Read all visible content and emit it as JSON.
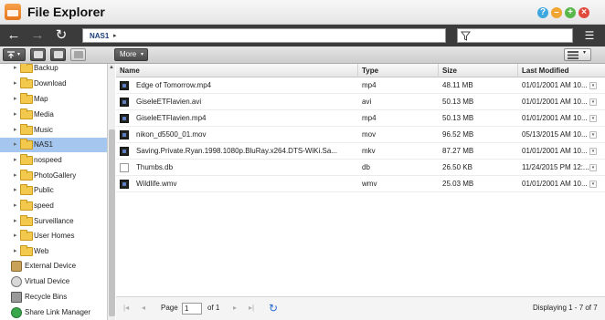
{
  "window": {
    "title": "File Explorer",
    "controls": [
      "?",
      "–",
      "+",
      "×"
    ]
  },
  "nav": {
    "back_icon": "←",
    "forward_icon": "→",
    "refresh_icon": "↻",
    "path_segment": "NAS1",
    "path_arrow": "▸",
    "filter_icon": "filter-icon",
    "filter_value": "",
    "view_icon": "☰"
  },
  "toolbar": {
    "more_label": "More",
    "more_arrow": "▾"
  },
  "sidebar": {
    "folders": [
      {
        "label": "Backup"
      },
      {
        "label": "Download"
      },
      {
        "label": "Map"
      },
      {
        "label": "Media"
      },
      {
        "label": "Music"
      },
      {
        "label": "NAS1",
        "selected": true
      },
      {
        "label": "nospeed"
      },
      {
        "label": "PhotoGallery"
      },
      {
        "label": "Public"
      },
      {
        "label": "speed"
      },
      {
        "label": "Surveillance"
      },
      {
        "label": "User Homes"
      },
      {
        "label": "Web"
      }
    ],
    "roots": [
      {
        "label": "External Device",
        "icon": "external-device-icon"
      },
      {
        "label": "Virtual Device",
        "icon": "virtual-device-icon"
      },
      {
        "label": "Recycle Bins",
        "icon": "recycle-bin-icon"
      },
      {
        "label": "Share Link Manager",
        "icon": "share-link-icon"
      }
    ]
  },
  "grid": {
    "columns": [
      "Name",
      "Type",
      "Size",
      "Last Modified"
    ],
    "rows": [
      {
        "name": "Edge of Tomorrow.mp4",
        "type": "mp4",
        "size": "48.11 MB",
        "modified": "01/01/2001 AM 10...",
        "icon": "video"
      },
      {
        "name": "GiseleETFlavien.avi",
        "type": "avi",
        "size": "50.13 MB",
        "modified": "01/01/2001 AM 10...",
        "icon": "video"
      },
      {
        "name": "GiseleETFlavien.mp4",
        "type": "mp4",
        "size": "50.13 MB",
        "modified": "01/01/2001 AM 10...",
        "icon": "video"
      },
      {
        "name": "nikon_d5500_01.mov",
        "type": "mov",
        "size": "96.52 MB",
        "modified": "05/13/2015 AM 10...",
        "icon": "video"
      },
      {
        "name": "Saving.Private.Ryan.1998.1080p.BluRay.x264.DTS-WiKi.Sa...",
        "type": "mkv",
        "size": "87.27 MB",
        "modified": "01/01/2001 AM 10...",
        "icon": "video"
      },
      {
        "name": "Thumbs.db",
        "type": "db",
        "size": "26.50 KB",
        "modified": "11/24/2015 PM 12:...",
        "icon": "doc"
      },
      {
        "name": "Wildlife.wmv",
        "type": "wmv",
        "size": "25.03 MB",
        "modified": "01/01/2001 AM 10...",
        "icon": "video"
      }
    ]
  },
  "pager": {
    "first_icon": "|◂",
    "prev_icon": "◂",
    "page_label": "Page",
    "page_value": "1",
    "of_label": "of 1",
    "next_icon": "▸",
    "last_icon": "▸|",
    "refresh_icon": "↻",
    "displaying": "Displaying 1 - 7 of 7"
  }
}
